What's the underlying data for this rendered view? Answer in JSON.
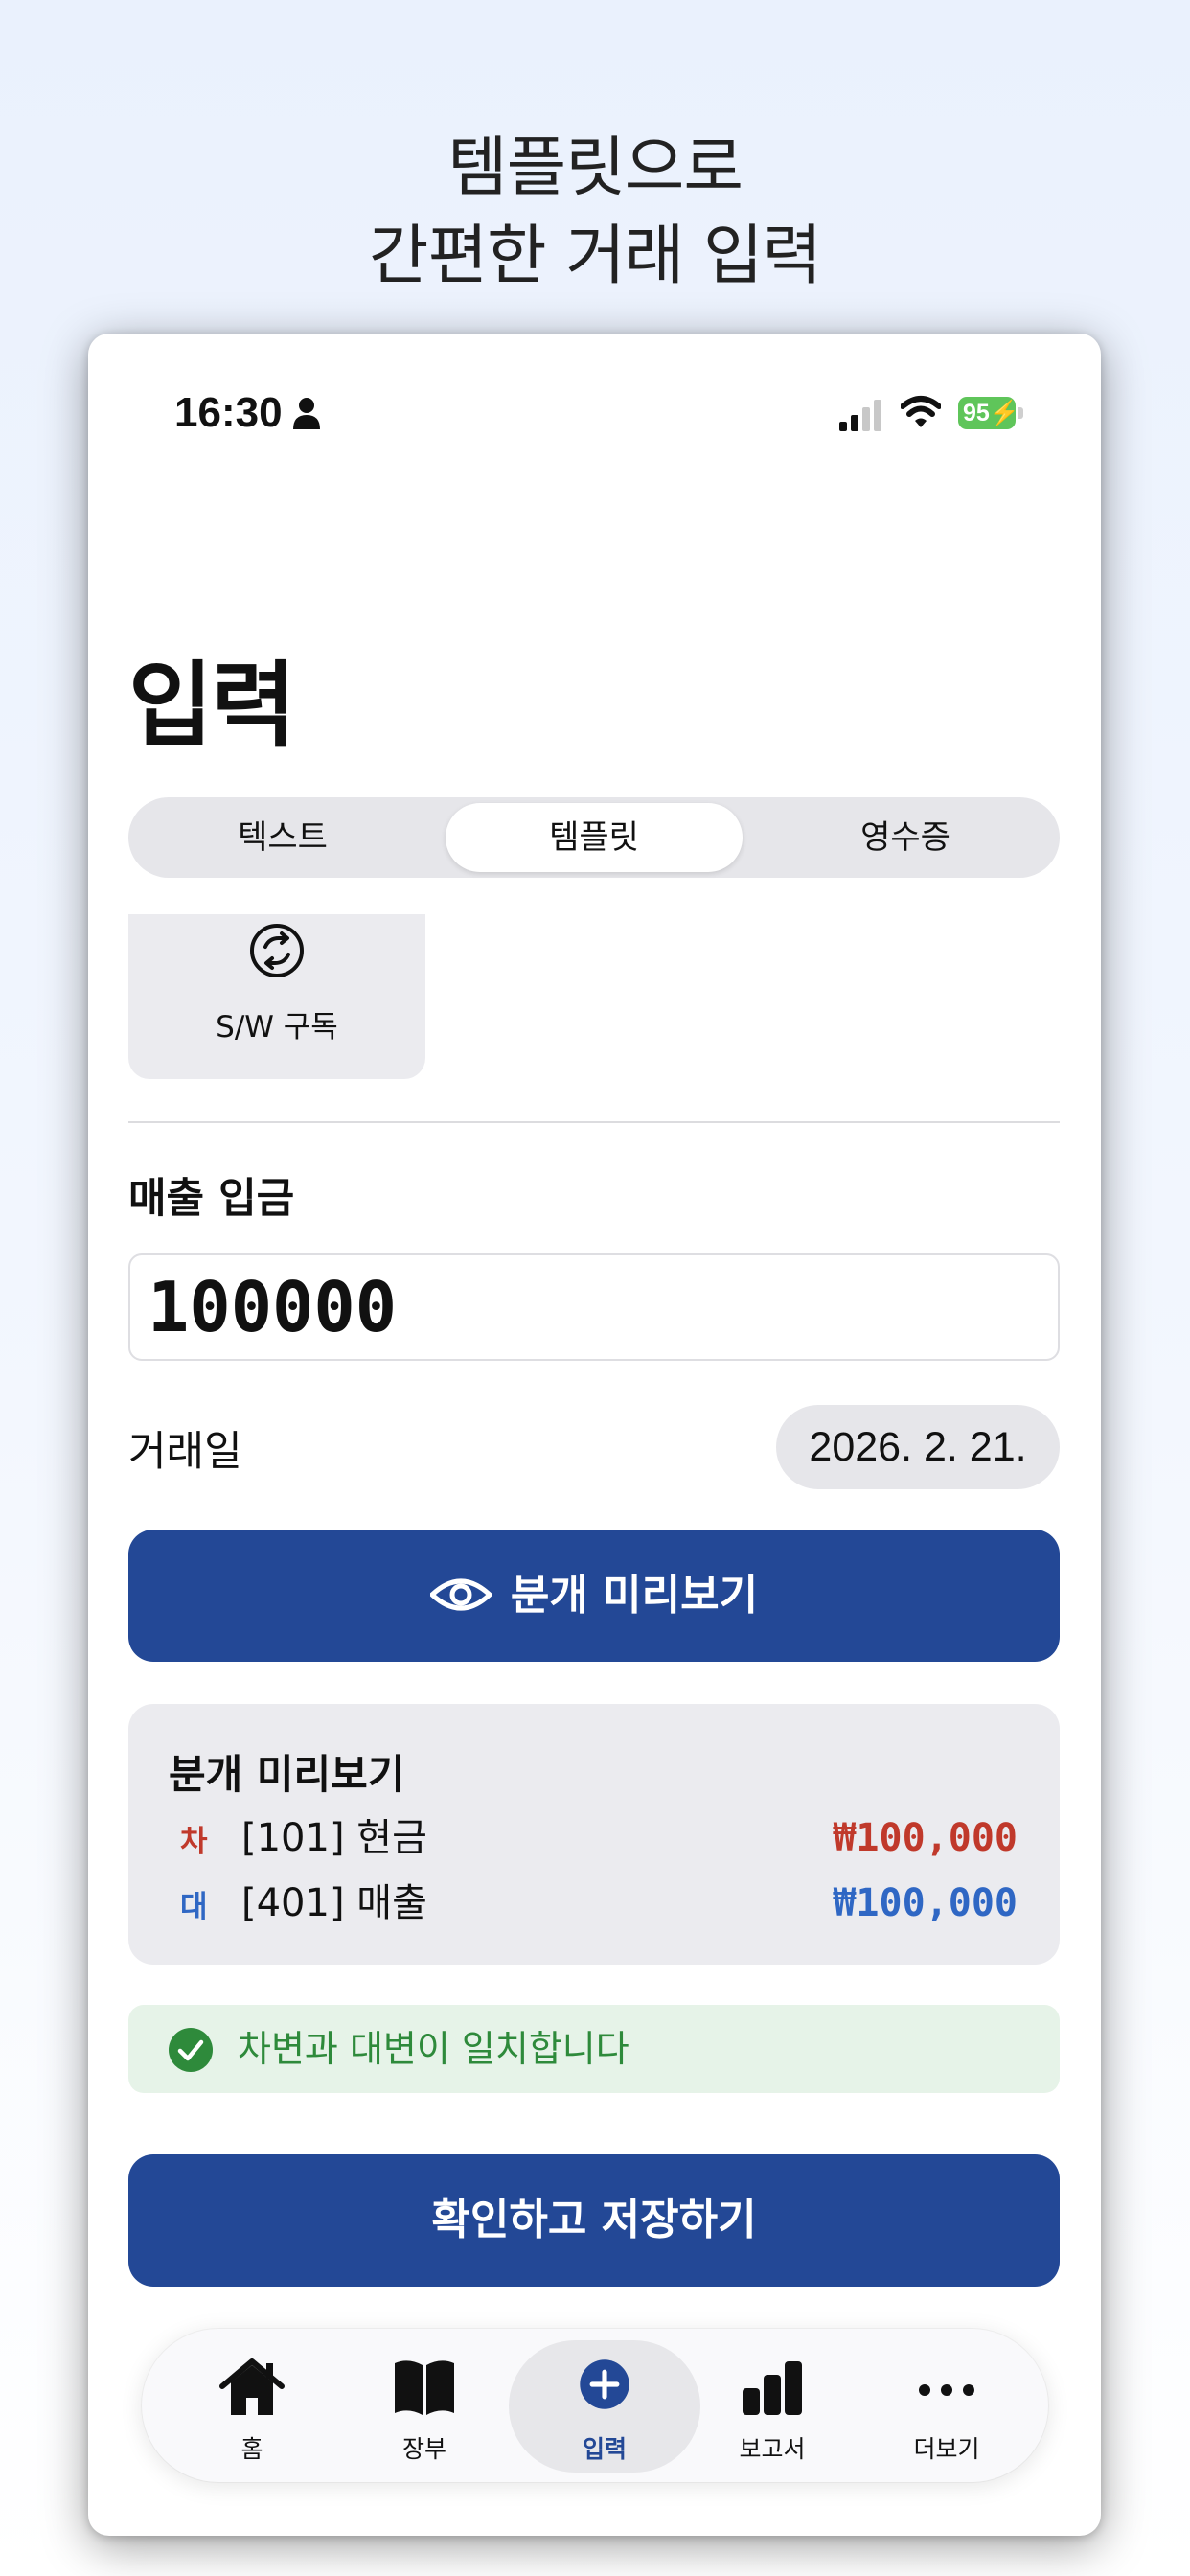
{
  "headline": {
    "line1": "템플릿으로",
    "line2": "간편한 거래 입력"
  },
  "status_bar": {
    "time": "16:30",
    "battery": "95"
  },
  "page_title": "입력",
  "segments": {
    "items": [
      "텍스트",
      "템플릿",
      "영수증"
    ],
    "selected": "템플릿"
  },
  "template": {
    "label": "S/W 구독",
    "icon": "sync-circle-icon"
  },
  "entry": {
    "title": "매출 입금",
    "amount": "100000",
    "date_label": "거래일",
    "date_value": "2026. 2. 21."
  },
  "preview_button": "분개 미리보기",
  "journal_preview": {
    "title": "분개 미리보기",
    "rows": [
      {
        "side": "차",
        "account": "[101] 현금",
        "amount": "₩100,000",
        "color": "#c0392b"
      },
      {
        "side": "대",
        "account": "[401] 매출",
        "amount": "₩100,000",
        "color": "#2f67c4"
      }
    ]
  },
  "balance_status": "차변과 대변이 일치합니다",
  "save_button": "확인하고 저장하기",
  "tabbar": {
    "items": [
      {
        "label": "홈",
        "icon": "house-icon"
      },
      {
        "label": "장부",
        "icon": "book-icon"
      },
      {
        "label": "입력",
        "icon": "plus-circle-icon"
      },
      {
        "label": "보고서",
        "icon": "bar-chart-icon"
      },
      {
        "label": "더보기",
        "icon": "ellipsis-icon"
      }
    ],
    "active": "입력"
  },
  "colors": {
    "primary": "#234896",
    "debit": "#c0392b",
    "credit": "#2f67c4",
    "success": "#2e8a3b",
    "battery": "#5fc55a"
  }
}
